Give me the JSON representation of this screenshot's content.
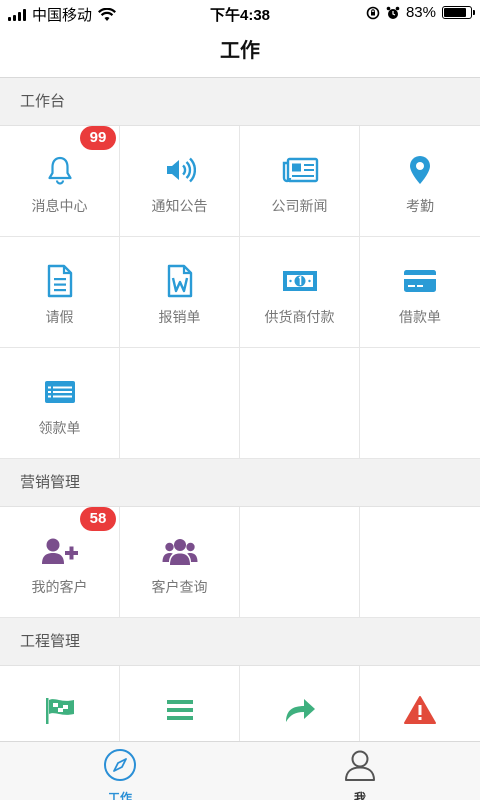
{
  "status_bar": {
    "carrier": "中国移动",
    "time": "下午4:38",
    "battery_percent": "83%",
    "battery_level": 0.83
  },
  "nav": {
    "title": "工作"
  },
  "colors": {
    "blue": "#2a9bd6",
    "purple": "#7a4e8c",
    "green": "#3fb07f",
    "red": "#e24a3b",
    "badge": "#ea3b3b"
  },
  "sections": [
    {
      "title": "工作台",
      "items": [
        {
          "label": "消息中心",
          "icon": "bell-icon",
          "badge": "99"
        },
        {
          "label": "通知公告",
          "icon": "speaker-icon"
        },
        {
          "label": "公司新闻",
          "icon": "newspaper-icon"
        },
        {
          "label": "考勤",
          "icon": "map-pin-icon"
        },
        {
          "label": "请假",
          "icon": "document-icon"
        },
        {
          "label": "报销单",
          "icon": "word-document-icon"
        },
        {
          "label": "供货商付款",
          "icon": "banknote-icon"
        },
        {
          "label": "借款单",
          "icon": "credit-card-icon"
        },
        {
          "label": "领款单",
          "icon": "list-card-icon"
        }
      ]
    },
    {
      "title": "营销管理",
      "items": [
        {
          "label": "我的客户",
          "icon": "add-user-icon",
          "badge": "58"
        },
        {
          "label": "客户查询",
          "icon": "user-group-icon"
        }
      ]
    },
    {
      "title": "工程管理",
      "items": [
        {
          "label": "",
          "icon": "flag-icon"
        },
        {
          "label": "",
          "icon": "menu-lines-icon"
        },
        {
          "label": "",
          "icon": "share-arrow-icon"
        },
        {
          "label": "",
          "icon": "warning-icon"
        }
      ]
    }
  ],
  "tabs": [
    {
      "label": "工作",
      "icon": "compass-icon",
      "active": true
    },
    {
      "label": "我",
      "icon": "person-icon",
      "active": false
    }
  ]
}
